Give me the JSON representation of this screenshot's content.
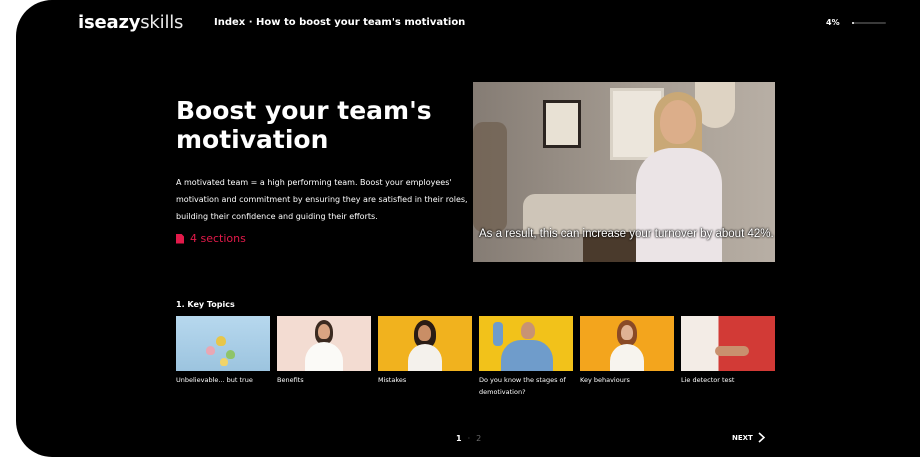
{
  "header": {
    "logo_bold": "iseazy",
    "logo_light": "skills",
    "breadcrumb": "Index · How to boost your team's motivation",
    "progress_text": "4%",
    "progress_value": 0.04
  },
  "intro": {
    "title": "Boost your team's motivation",
    "description": "A motivated team = a high performing team. Boost your employees' motivation and commitment by ensuring they are satisfied in their roles, building their confidence and guiding their efforts.",
    "sections_label": "4 sections",
    "sections_icon": "document-icon",
    "accent_color": "#e21a4a"
  },
  "video": {
    "caption": "As a result, this can increase your turnover by about 42%."
  },
  "topics": {
    "heading": "1. Key Topics",
    "items": [
      {
        "label": "Unbelievable... but true",
        "color": "#a9cde6"
      },
      {
        "label": "Benefits",
        "color": "#f4d6cc"
      },
      {
        "label": "Mistakes",
        "color": "#f1b21e"
      },
      {
        "label": "Do you know the stages of demotivation?",
        "color": "#f2c21a"
      },
      {
        "label": "Key behaviours",
        "color": "#f3a51d"
      },
      {
        "label": "Lie detector test",
        "color": "#d23a36"
      }
    ]
  },
  "pagination": {
    "current": "1",
    "separator": "·",
    "next_page": "2",
    "next_label": "NEXT"
  }
}
